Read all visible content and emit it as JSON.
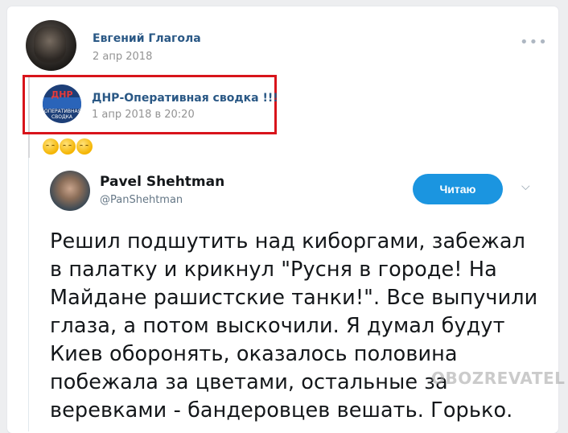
{
  "post": {
    "author": "Евгений Глагола",
    "date": "2 апр 2018",
    "more_label": "•••"
  },
  "repost": {
    "source_name": "ДНР-Оперативная сводка !!!",
    "source_date": "1 апр 2018 в 20:20",
    "avatar_text": "ДНР",
    "avatar_subtext": "ОПЕРАТИВНАЯ СВОДКА",
    "emojis": [
      "😌",
      "😌",
      "😌"
    ],
    "highlight_color": "#d8141b"
  },
  "tweet": {
    "name": "Pavel Shehtman",
    "handle": "@PanShehtman",
    "follow_label": "Читаю",
    "chevron": "⌵",
    "lines": [
      "Решил подшутить над киборгами, забежал",
      "в палатку и крикнул \"Русня в городе! На",
      "Майдане рашистские танки!\". Все выпучили",
      "глаза, а потом выскочили. Я думал будут",
      "Киев оборонять, оказалось половина",
      "побежала за цветами, остальные за",
      "веревками - бандеровцев вешать. Горько."
    ]
  },
  "watermark": "OBOZREVATEL",
  "colors": {
    "link": "#2a5885",
    "muted": "#939393",
    "twitter_blue": "#1b95e0"
  }
}
